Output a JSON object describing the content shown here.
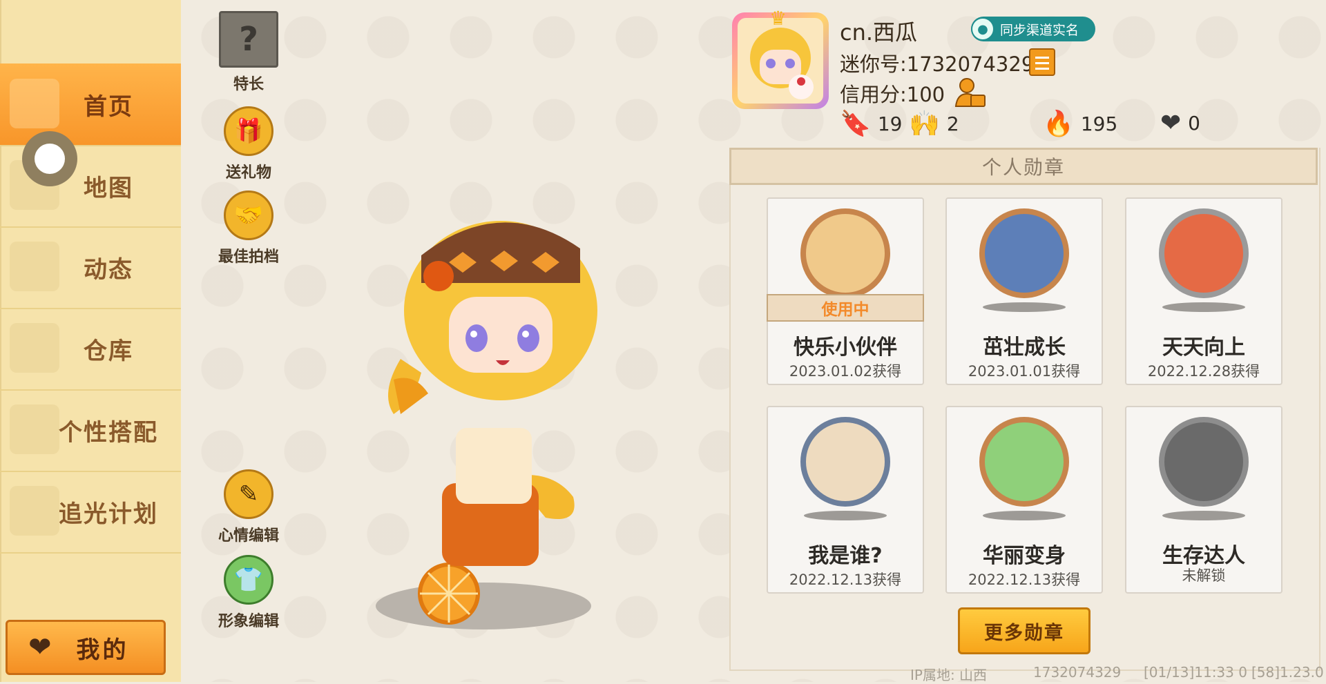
{
  "sidebar": {
    "items": [
      {
        "label": "首页",
        "active": true
      },
      {
        "label": "地图"
      },
      {
        "label": "动态"
      },
      {
        "label": "仓库"
      },
      {
        "label": "个性搭配"
      },
      {
        "label": "追光计划"
      }
    ],
    "mine_label": "我的"
  },
  "actions": {
    "skill": "特长",
    "gift": "送礼物",
    "partner": "最佳拍档",
    "mood": "心情编辑",
    "avatar_edit": "形象编辑"
  },
  "profile": {
    "username": "cn.西瓜",
    "sync_badge": "同步渠道实名",
    "mini_id": "迷你号:1732074329",
    "credit": "信用分:100",
    "stats": {
      "add": "19",
      "fans": "2",
      "fire": "195",
      "likes": "0"
    }
  },
  "medals": {
    "title": "个人勋章",
    "in_use_label": "使用中",
    "items": [
      {
        "name": "快乐小伙伴",
        "date": "2023.01.02获得",
        "color": "#c7854c"
      },
      {
        "name": "茁壮成长",
        "date": "2023.01.01获得",
        "color": "#c7854c"
      },
      {
        "name": "天天向上",
        "date": "2022.12.28获得",
        "color": "#9a9a9a"
      },
      {
        "name": "我是谁?",
        "date": "2022.12.13获得",
        "color": "#6c7f9c"
      },
      {
        "name": "华丽变身",
        "date": "2022.12.13获得",
        "color": "#c7854c"
      },
      {
        "name": "生存达人",
        "date": "未解锁",
        "color": "#8d8d8d"
      }
    ],
    "more_label": "更多勋章"
  },
  "footer": {
    "ip": "IP属地: 山西",
    "id": "1732074329",
    "time": "[01/13]11:33 0",
    "version": "[58]1.23.0"
  }
}
